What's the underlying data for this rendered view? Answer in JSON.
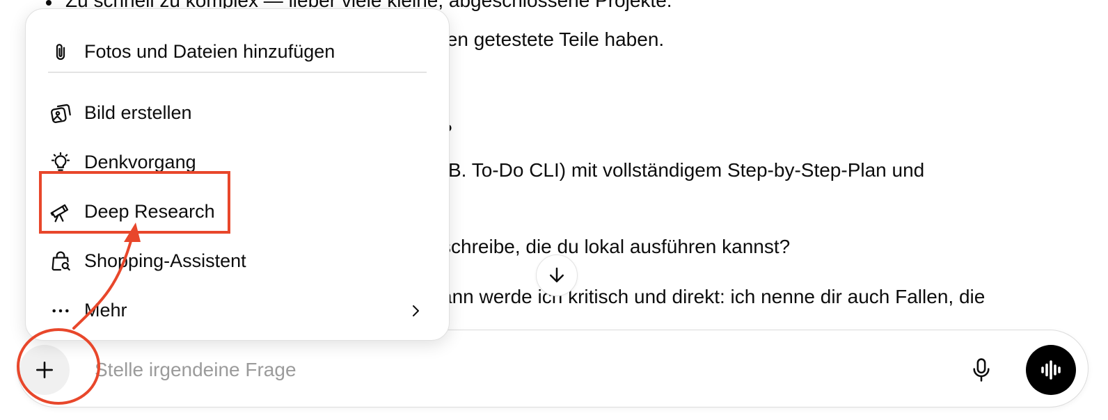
{
  "chat": {
    "lines": [
      "Zu schnell zu komplex — lieber viele kleine, abgeschlossene Projekte.",
      "ten getestete Teile haben.",
      "?",
      "B. To-Do CLI) mit vollständigem Step-by-Step-Plan und",
      "schreibe, die du lokal ausführen kannst?",
      "ann werde ich kritisch und direkt: ich nenne dir auch Fallen, die"
    ]
  },
  "menu": {
    "items": [
      {
        "label": "Fotos und Dateien hinzufügen",
        "icon": "paperclip-icon"
      },
      {
        "label": "Bild erstellen",
        "icon": "image-create-icon"
      },
      {
        "label": "Denkvorgang",
        "icon": "lightbulb-icon"
      },
      {
        "label": "Deep Research",
        "icon": "telescope-icon"
      },
      {
        "label": "Shopping-Assistent",
        "icon": "shopping-bag-search-icon"
      },
      {
        "label": "Mehr",
        "icon": "more-dots-icon"
      }
    ]
  },
  "composer": {
    "placeholder": "Stelle irgendeine Frage"
  },
  "colors": {
    "annotation": "#e8472b",
    "voice_button": "#000000"
  }
}
